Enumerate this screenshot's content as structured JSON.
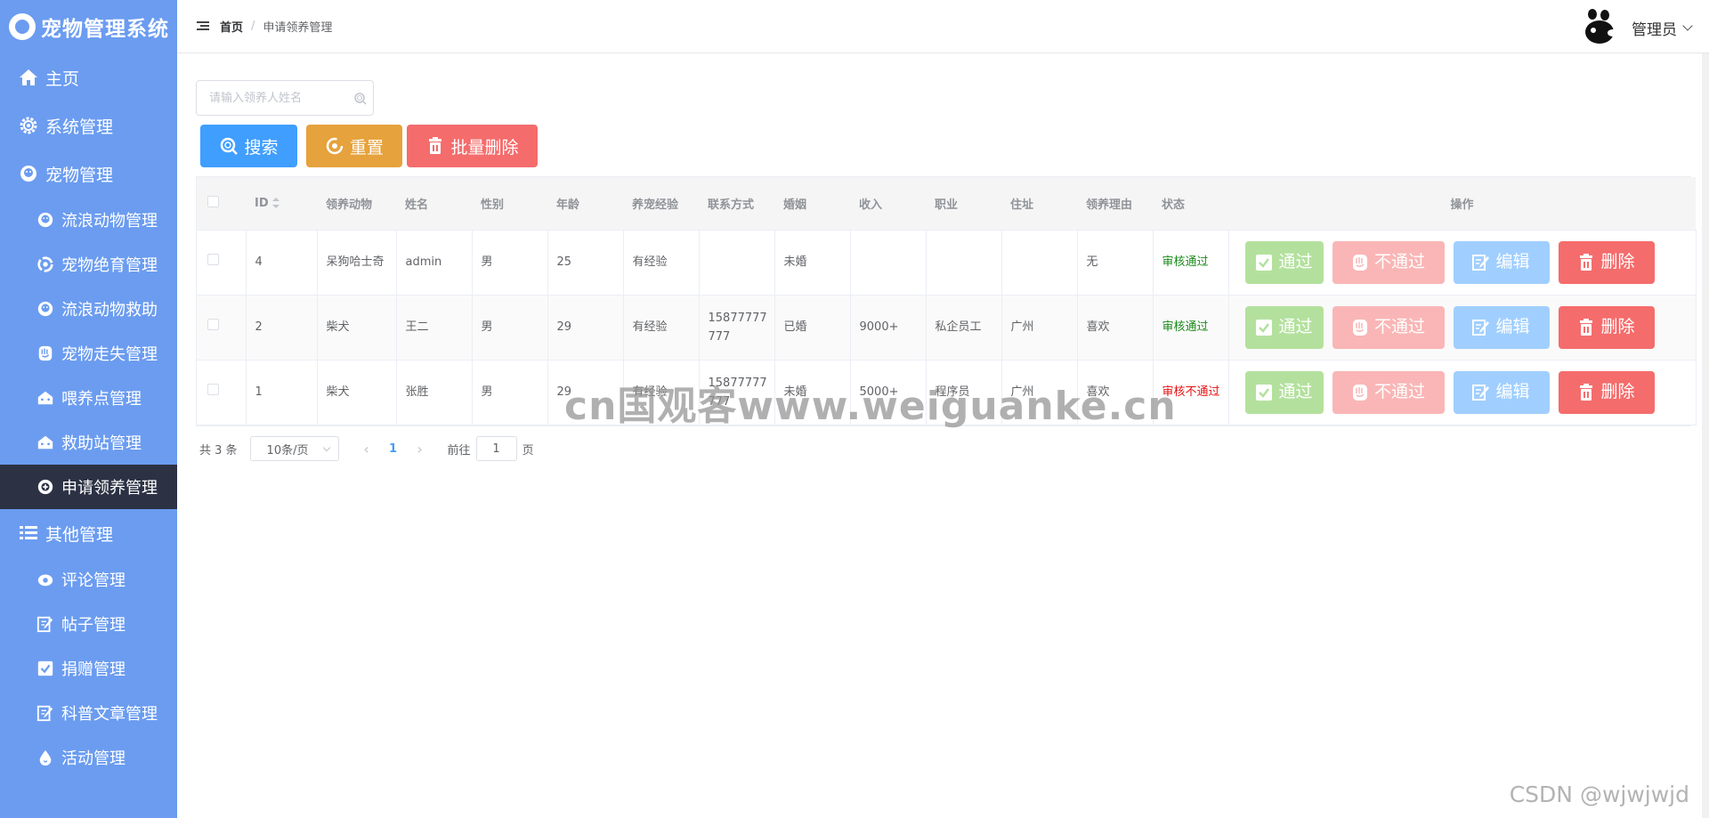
{
  "app": {
    "title": "宠物管理系统"
  },
  "sidebar": {
    "items": [
      {
        "label": "主页",
        "icon": "home-icon"
      },
      {
        "label": "系统管理",
        "icon": "gear-icon"
      },
      {
        "label": "宠物管理",
        "icon": "pet-icon"
      },
      {
        "label": "流浪动物管理",
        "icon": "pet-face-icon"
      },
      {
        "label": "宠物绝育管理",
        "icon": "target-icon"
      },
      {
        "label": "流浪动物救助",
        "icon": "pet-face-icon"
      },
      {
        "label": "宠物走失管理",
        "icon": "hand-icon"
      },
      {
        "label": "喂养点管理",
        "icon": "house-icon"
      },
      {
        "label": "救助站管理",
        "icon": "house-icon"
      },
      {
        "label": "申请领养管理",
        "icon": "plus-circle-icon"
      },
      {
        "label": "其他管理",
        "icon": "list-icon"
      },
      {
        "label": "评论管理",
        "icon": "cloud-gear-icon"
      },
      {
        "label": "帖子管理",
        "icon": "edit-icon"
      },
      {
        "label": "捐赠管理",
        "icon": "check-box-icon"
      },
      {
        "label": "科普文章管理",
        "icon": "edit-icon"
      },
      {
        "label": "活动管理",
        "icon": "drop-icon"
      }
    ]
  },
  "header": {
    "breadcrumb_home": "首页",
    "breadcrumb_sep": "/",
    "breadcrumb_current": "申请领养管理",
    "user_name": "管理员"
  },
  "search": {
    "placeholder": "请输入领养人姓名",
    "value": ""
  },
  "toolbar": {
    "search_label": "搜索",
    "reset_label": "重置",
    "batch_delete_label": "批量删除"
  },
  "colors": {
    "sidebar": "#6b9cf0",
    "active": "#2c3244",
    "search_btn": "#409eff",
    "reset_btn": "#e6a23c",
    "delete_btn": "#f56c6c",
    "pass_btn": "#b3e19d",
    "reject_btn": "#fab6b6",
    "edit_btn": "#a0cfff"
  },
  "table": {
    "columns": [
      "ID",
      "领养动物",
      "姓名",
      "性别",
      "年龄",
      "养宠经验",
      "联系方式",
      "婚姻",
      "收入",
      "职业",
      "住址",
      "领养理由",
      "状态",
      "操作"
    ],
    "rows": [
      {
        "id": "4",
        "animal": "呆狗哈士奇",
        "name": "admin",
        "gender": "男",
        "age": "25",
        "exp": "有经验",
        "phone": "",
        "marriage": "未婚",
        "income": "",
        "job": "",
        "address": "",
        "reason": "无",
        "status": "审核通过",
        "status_type": "ok"
      },
      {
        "id": "2",
        "animal": "柴犬",
        "name": "王二",
        "gender": "男",
        "age": "29",
        "exp": "有经验",
        "phone": "15877777777",
        "marriage": "已婚",
        "income": "9000+",
        "job": "私企员工",
        "address": "广州",
        "reason": "喜欢",
        "status": "审核通过",
        "status_type": "ok"
      },
      {
        "id": "1",
        "animal": "柴犬",
        "name": "张胜",
        "gender": "男",
        "age": "29",
        "exp": "有经验",
        "phone": "15877777777",
        "marriage": "未婚",
        "income": "5000+",
        "job": "程序员",
        "address": "广州",
        "reason": "喜欢",
        "status": "审核不通过",
        "status_type": "bad"
      }
    ],
    "actions": {
      "pass": "通过",
      "reject": "不通过",
      "edit": "编辑",
      "delete": "删除"
    }
  },
  "pagination": {
    "total_text": "共 3 条",
    "page_size": "10条/页",
    "current_page": "1",
    "goto_label": "前往",
    "goto_value": "1",
    "page_suffix": "页"
  },
  "watermarks": {
    "main": "cn国观客www.weiguanke.cn",
    "corner": "CSDN @wjwjwjd"
  }
}
